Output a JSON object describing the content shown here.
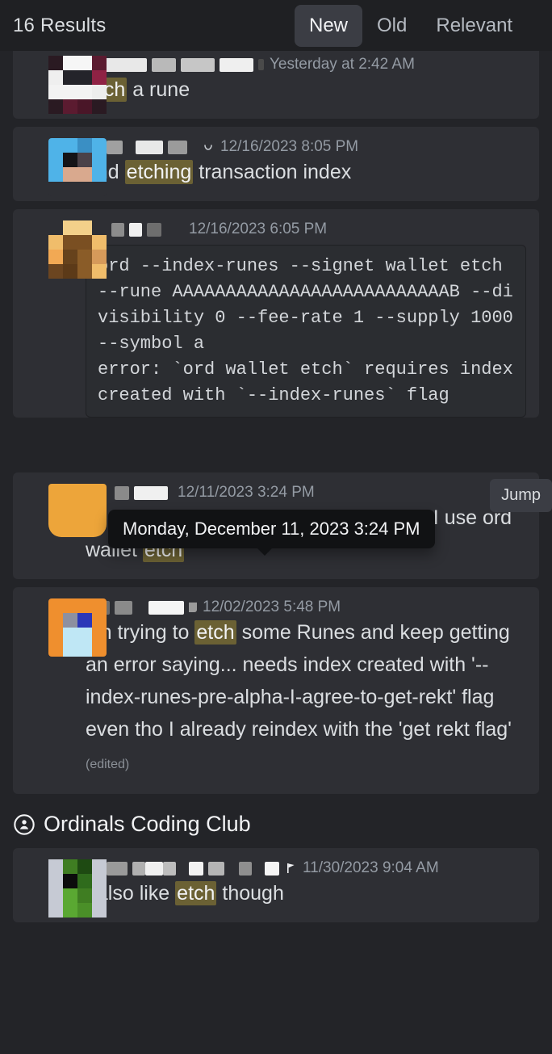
{
  "header": {
    "results_count": "16 Results",
    "sort_tabs": [
      {
        "label": "New",
        "active": true
      },
      {
        "label": "Old",
        "active": false
      },
      {
        "label": "Relevant",
        "active": false
      }
    ]
  },
  "tooltip": {
    "text": "Monday, December 11, 2023 3:24 PM"
  },
  "jump_button": {
    "label": "Jump"
  },
  "group_header": {
    "icon": "stage-channel-icon",
    "name": "Ordinals Coding Club"
  },
  "results": [
    {
      "avatar": "pixel-avatar-white-maroon",
      "username_redacted": true,
      "timestamp": "Yesterday at 2:42 AM",
      "message_pre": "",
      "message_highlight": "etch",
      "message_post": " a rune",
      "edited": ""
    },
    {
      "avatar": "pixel-avatar-blue",
      "username_redacted": true,
      "timestamp": "12/16/2023 8:05 PM",
      "message_pre": "and ",
      "message_highlight": "etching",
      "message_post": " transaction index",
      "edited": ""
    },
    {
      "avatar": "pixel-avatar-tan-brown",
      "username_redacted": true,
      "timestamp": "12/16/2023 6:05 PM",
      "code": "ord --index-runes --signet wallet etch --rune AAAAAAAAAAAAAAAAAAAAAAAAAAB --divisibility 0 --fee-rate 1 --supply 1000 --symbol a\nerror: `ord wallet etch` requires index created with `--index-runes` flag"
    },
    {
      "avatar": "plain-avatar-orange",
      "username_redacted": true,
      "timestamp": "12/11/2023 3:24 PM",
      "message_pre": "If I want to deloy an inscription, should I use ord wallet ",
      "message_highlight": "etch",
      "message_post": "",
      "edited": ""
    },
    {
      "avatar": "pixel-avatar-orange-blue",
      "username_redacted": true,
      "timestamp": "12/02/2023 5:48 PM",
      "message_pre": "I'm trying to ",
      "message_highlight": "etch",
      "message_post": " some Runes and keep getting an error saying... needs index created with '--index-runes-pre-alpha-I-agree-to-get-rekt' flag even tho I already reindex with the 'get rekt flag' ",
      "edited": "(edited)"
    },
    {
      "avatar": "pixel-avatar-green",
      "username_redacted": true,
      "timestamp": "11/30/2023 9:04 AM",
      "message_pre": "I also like ",
      "message_highlight": "etch",
      "message_post": " though",
      "edited": ""
    }
  ],
  "colors": {
    "page_bg": "#232428",
    "card_bg": "#2e2f34",
    "header_bg": "#1f2023",
    "highlight": "#6b6134",
    "text": "#dbdee1",
    "muted": "#949ba4",
    "tooltip_bg": "#111214",
    "active_tab_bg": "#3b3d44"
  }
}
